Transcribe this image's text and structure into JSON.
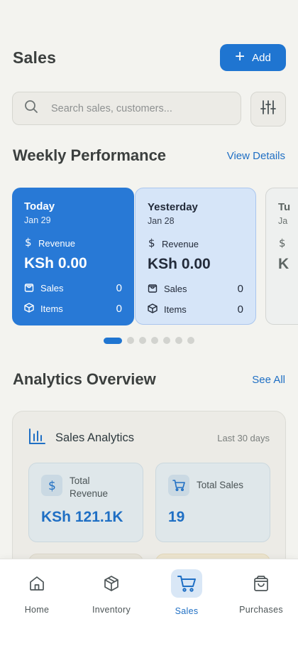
{
  "header": {
    "title": "Sales",
    "add_label": "Add"
  },
  "search": {
    "placeholder": "Search sales, customers..."
  },
  "weekly": {
    "title": "Weekly Performance",
    "link": "View Details",
    "cards": [
      {
        "day": "Today",
        "date": "Jan 29",
        "revenue_label": "Revenue",
        "revenue": "KSh 0.00",
        "sales_label": "Sales",
        "sales": "0",
        "items_label": "Items",
        "items": "0"
      },
      {
        "day": "Yesterday",
        "date": "Jan 28",
        "revenue_label": "Revenue",
        "revenue": "KSh 0.00",
        "sales_label": "Sales",
        "sales": "0",
        "items_label": "Items",
        "items": "0"
      },
      {
        "day": "Tu",
        "date": "Ja",
        "revenue_value_partial": "K"
      }
    ],
    "page_dots": {
      "count": 7,
      "active": 0
    }
  },
  "analytics": {
    "title": "Analytics Overview",
    "link": "See All",
    "card_title": "Sales Analytics",
    "period": "Last 30 days",
    "metrics": [
      {
        "label": "Total Revenue",
        "value": "KSh 121.1K",
        "icon": "dollar-icon"
      },
      {
        "label": "Total Sales",
        "value": "19",
        "icon": "cart-icon"
      }
    ]
  },
  "nav": {
    "items": [
      {
        "label": "Home",
        "icon": "home-icon"
      },
      {
        "label": "Inventory",
        "icon": "box-icon"
      },
      {
        "label": "Sales",
        "icon": "cart-icon",
        "active": true
      },
      {
        "label": "Purchases",
        "icon": "bag-icon"
      }
    ]
  },
  "colors": {
    "accent": "#1f75d1",
    "background": "#f3f3ef",
    "card_active": "#2879d6",
    "card_secondary": "#d6e5f8"
  }
}
